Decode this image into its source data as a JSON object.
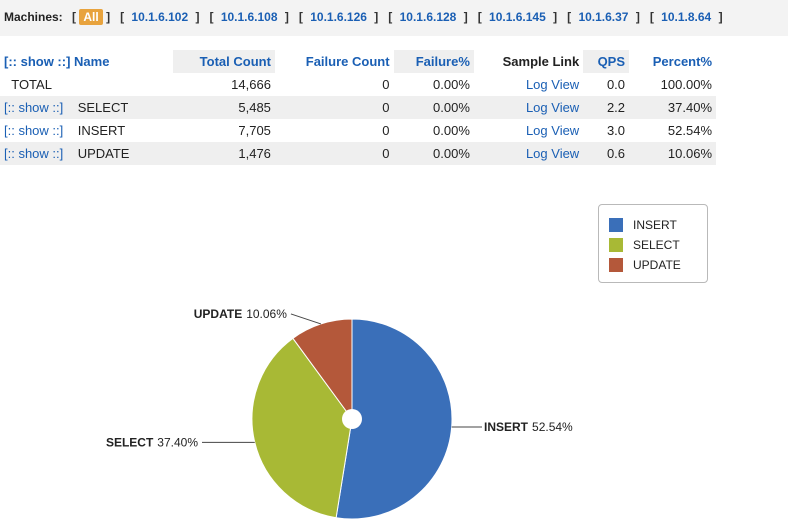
{
  "machines": {
    "label": "Machines:",
    "items": [
      {
        "label": "All",
        "active": true
      },
      {
        "label": "10.1.6.102"
      },
      {
        "label": "10.1.6.108"
      },
      {
        "label": "10.1.6.126"
      },
      {
        "label": "10.1.6.128"
      },
      {
        "label": "10.1.6.145"
      },
      {
        "label": "10.1.6.37"
      },
      {
        "label": "10.1.8.64"
      }
    ]
  },
  "table": {
    "headers": {
      "show": "[:: show ::]",
      "name": "Name",
      "total": "Total Count",
      "failure": "Failure Count",
      "failure_pct": "Failure%",
      "sample": "Sample Link",
      "qps": "QPS",
      "percent": "Percent%"
    },
    "rows": [
      {
        "show": "",
        "name": "TOTAL",
        "total": "14,666",
        "failure": "0",
        "failure_pct": "0.00%",
        "sample": "Log View",
        "qps": "0.0",
        "percent": "100.00%"
      },
      {
        "show": "[:: show ::]",
        "name": "SELECT",
        "total": "5,485",
        "failure": "0",
        "failure_pct": "0.00%",
        "sample": "Log View",
        "qps": "2.2",
        "percent": "37.40%"
      },
      {
        "show": "[:: show ::]",
        "name": "INSERT",
        "total": "7,705",
        "failure": "0",
        "failure_pct": "0.00%",
        "sample": "Log View",
        "qps": "3.0",
        "percent": "52.54%"
      },
      {
        "show": "[:: show ::]",
        "name": "UPDATE",
        "total": "1,476",
        "failure": "0",
        "failure_pct": "0.00%",
        "sample": "Log View",
        "qps": "0.6",
        "percent": "10.06%"
      }
    ]
  },
  "chart_data": {
    "type": "pie",
    "slices": [
      {
        "name": "INSERT",
        "value": 52.54,
        "label": "52.54%",
        "color": "#3a6fb9"
      },
      {
        "name": "SELECT",
        "value": 37.4,
        "label": "37.40%",
        "color": "#a8b935"
      },
      {
        "name": "UPDATE",
        "value": 10.06,
        "label": "10.06%",
        "color": "#b4583a"
      }
    ],
    "legend_placement": "top-right",
    "donut_hole": true
  }
}
